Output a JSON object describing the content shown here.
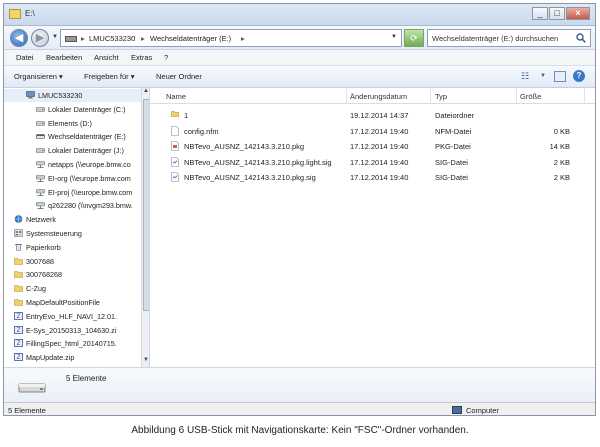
{
  "window": {
    "title": "E:\\",
    "min": "_",
    "max": "□",
    "close": "×"
  },
  "address": {
    "crumbs": [
      "LMUC533230",
      "Wechseldatenträger (E:)"
    ],
    "sep": "▸",
    "search_placeholder": "Wechseldatenträger (E:) durchsuchen"
  },
  "menu": [
    "Datei",
    "Bearbeiten",
    "Ansicht",
    "Extras",
    "?"
  ],
  "toolbar": {
    "organize": "Organisieren ▾",
    "share": "Freigeben für ▾",
    "new_folder": "Neuer Ordner"
  },
  "nav": [
    {
      "label": "LMUC533230",
      "icon": "computer",
      "indent": 1,
      "sel": true
    },
    {
      "label": "Lokaler Datenträger (C:)",
      "icon": "drive",
      "indent": 2
    },
    {
      "label": "Elements (D:)",
      "icon": "drive",
      "indent": 2
    },
    {
      "label": "Wechseldatenträger (E:)",
      "icon": "usb",
      "indent": 2
    },
    {
      "label": "Lokaler Datenträger (J:)",
      "icon": "drive",
      "indent": 2
    },
    {
      "label": "netapps (\\\\europe.bmw.co",
      "icon": "netdrive",
      "indent": 2
    },
    {
      "label": "EI-org (\\\\europe.bmw.com",
      "icon": "netdrive",
      "indent": 2
    },
    {
      "label": "EI-proj (\\\\europe.bmw.com",
      "icon": "netdrive",
      "indent": 2
    },
    {
      "label": "q262280 (\\\\nvgm293.bmw.",
      "icon": "netdrive",
      "indent": 2
    },
    {
      "label": "Netzwerk",
      "icon": "network",
      "indent": 0
    },
    {
      "label": "Systemsteuerung",
      "icon": "control",
      "indent": 0
    },
    {
      "label": "Papierkorb",
      "icon": "recycle",
      "indent": 0
    },
    {
      "label": "3007688",
      "icon": "folder",
      "indent": 0
    },
    {
      "label": "300768268",
      "icon": "folder",
      "indent": 0
    },
    {
      "label": "C-Zug",
      "icon": "folder",
      "indent": 0
    },
    {
      "label": "MapDefaultPositionFile",
      "icon": "folder",
      "indent": 0
    },
    {
      "label": "EntryEvo_HLF_NAVI_12.01.",
      "icon": "zip",
      "indent": 0
    },
    {
      "label": "E-Sys_20150313_104630.zi",
      "icon": "zip",
      "indent": 0
    },
    {
      "label": "FillingSpec_html_20140715.",
      "icon": "zip",
      "indent": 0
    },
    {
      "label": "MapUpdate.zip",
      "icon": "zip",
      "indent": 0
    }
  ],
  "columns": [
    "Name",
    "Änderungsdatum",
    "Typ",
    "Größe"
  ],
  "files": [
    {
      "name": "1",
      "date": "19.12.2014 14:37",
      "type": "Dateiordner",
      "size": "",
      "icon": "folder"
    },
    {
      "name": "config.nfm",
      "date": "17.12.2014 19:40",
      "type": "NFM-Datei",
      "size": "0 KB",
      "icon": "file"
    },
    {
      "name": "NBTevo_AUSNZ_142143.3.210.pkg",
      "date": "17.12.2014 19:40",
      "type": "PKG-Datei",
      "size": "14 KB",
      "icon": "pkg"
    },
    {
      "name": "NBTevo_AUSNZ_142143.3.210.pkg.light.sig",
      "date": "17.12.2014 19:40",
      "type": "SIG-Datei",
      "size": "2 KB",
      "icon": "sig"
    },
    {
      "name": "NBTevo_AUSNZ_142143.3.210.pkg.sig",
      "date": "17.12.2014 19:40",
      "type": "SIG-Datei",
      "size": "2 KB",
      "icon": "sig"
    }
  ],
  "details": {
    "count": "5 Elemente"
  },
  "status": {
    "left": "5 Elemente",
    "right": "Computer"
  },
  "caption": "Abbildung 6 USB-Stick mit Navigationskarte: Kein \"FSC\"-Ordner vorhanden."
}
